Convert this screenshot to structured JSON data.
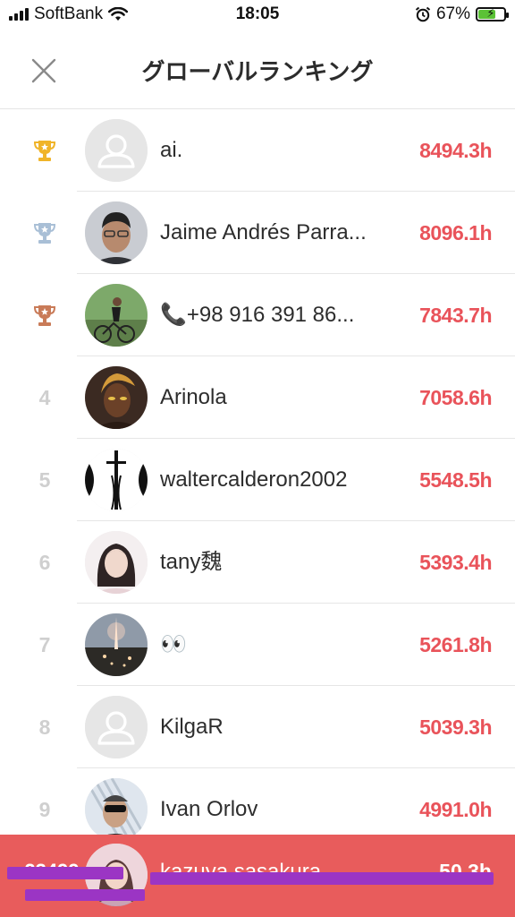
{
  "status": {
    "carrier": "SoftBank",
    "time": "18:05",
    "battery": "67%",
    "battery_level": 0.67
  },
  "header": {
    "title": "グローバルランキング"
  },
  "rows": [
    {
      "rank": "",
      "trophy": "gold",
      "name": "ai.",
      "hours": "8494.3h",
      "avatar": "placeholder"
    },
    {
      "rank": "",
      "trophy": "silver",
      "name": "Jaime Andrés Parra...",
      "hours": "8096.1h",
      "avatar": "photo"
    },
    {
      "rank": "",
      "trophy": "bronze",
      "name": "📞+98 916 391 86...",
      "hours": "7843.7h",
      "avatar": "photo"
    },
    {
      "rank": "4",
      "trophy": "",
      "name": "Arinola",
      "hours": "7058.6h",
      "avatar": "photo"
    },
    {
      "rank": "5",
      "trophy": "",
      "name": "waltercalderon2002",
      "hours": "5548.5h",
      "avatar": "photo"
    },
    {
      "rank": "6",
      "trophy": "",
      "name": "tany魏",
      "hours": "5393.4h",
      "avatar": "photo"
    },
    {
      "rank": "7",
      "trophy": "",
      "name": "👀",
      "hours": "5261.8h",
      "avatar": "photo"
    },
    {
      "rank": "8",
      "trophy": "",
      "name": "KilgaR",
      "hours": "5039.3h",
      "avatar": "placeholder"
    },
    {
      "rank": "9",
      "trophy": "",
      "name": "Ivan Orlov",
      "hours": "4991.0h",
      "avatar": "photo"
    }
  ],
  "me": {
    "rank": "23499",
    "name": "kazuya sasakura",
    "hours": "50.3h"
  },
  "colors": {
    "accent": "#e9535a",
    "gold": "#f0b429",
    "silver": "#a9bfd6",
    "bronze": "#c97b58",
    "me_bar": "#e85c5c"
  }
}
